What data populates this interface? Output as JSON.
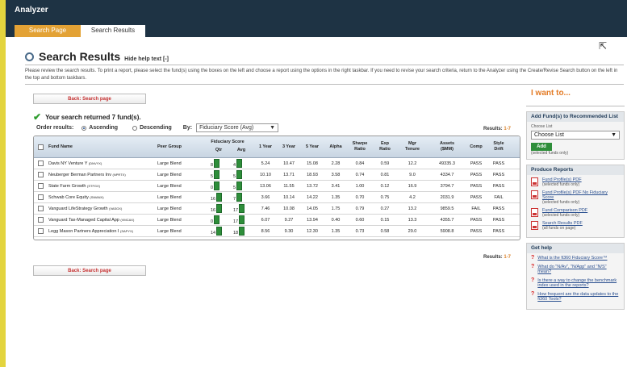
{
  "app": {
    "title": "Analyzer"
  },
  "tabs": [
    {
      "label": "Search Page"
    },
    {
      "label": "Search Results"
    }
  ],
  "header": {
    "title": "Search Results",
    "hide_help": "Hide help text [-]"
  },
  "help_text": "Please review the search results. To print a report, please select the fund(s) using the boxes on the left and choose a report using the options in the right taskbar. If you need to revise your search criteria, return to the Analyzer using the Create/Revise Search button on the left in the top and bottom taskbars.",
  "back_label": "Back: Search page",
  "result_message": "Your search returned 7 fund(s).",
  "order": {
    "label": "Order results:",
    "ascending": "Ascending",
    "descending": "Descending",
    "by_label": "By:",
    "by_value": "Fiduciary Score (Avg)"
  },
  "results_count": {
    "label": "Results:",
    "range": "1-7"
  },
  "table": {
    "headers": {
      "fund_name": "Fund Name",
      "peer_group": "Peer Group",
      "fiduciary_score": "Fiduciary Score",
      "qtr": "Qtr",
      "avg": "Avg",
      "y1": "1 Year",
      "y3": "3 Year",
      "y5": "5 Year",
      "alpha": "Alpha",
      "sharpe": "Sharpe Ratio",
      "exp": "Exp Ratio",
      "mgr": "Mgr Tenure",
      "assets": "Assets ($MM)",
      "comp": "Comp",
      "style": "Style Drift"
    },
    "rows": [
      {
        "name": "Davis NY Venture Y",
        "ticker": "(DNVYX)",
        "peer": "Large Blend",
        "qtr": "8",
        "avg": "4",
        "y1": "5.24",
        "y3": "10.47",
        "y5": "15.08",
        "alpha": "2.28",
        "sharpe": "0.84",
        "exp": "0.59",
        "mgr": "12.2",
        "assets": "49335.3",
        "comp": "PASS",
        "style": "PASS"
      },
      {
        "name": "Neuberger Berman Partners Inv",
        "ticker": "(NPRTX)",
        "peer": "Large Blend",
        "qtr": "5",
        "avg": "5",
        "y1": "10.10",
        "y3": "13.71",
        "y5": "18.93",
        "alpha": "3.58",
        "sharpe": "0.74",
        "exp": "0.81",
        "mgr": "9.0",
        "assets": "4334.7",
        "comp": "PASS",
        "style": "PASS"
      },
      {
        "name": "State Farm Growth",
        "ticker": "(STFGX)",
        "peer": "Large Blend",
        "qtr": "0",
        "avg": "5",
        "y1": "13.06",
        "y3": "11.55",
        "y5": "13.72",
        "alpha": "3.41",
        "sharpe": "1.00",
        "exp": "0.12",
        "mgr": "16.9",
        "assets": "3794.7",
        "comp": "PASS",
        "style": "PASS"
      },
      {
        "name": "Schwab Core Equity",
        "ticker": "(SWANX)",
        "peer": "Large Blend",
        "qtr": "16",
        "avg": "7",
        "y1": "3.66",
        "y3": "10.14",
        "y5": "14.22",
        "alpha": "1.35",
        "sharpe": "0.70",
        "exp": "0.75",
        "mgr": "4.2",
        "assets": "2031.9",
        "comp": "PASS",
        "style": "FAIL"
      },
      {
        "name": "Vanguard LifeStrategy Growth",
        "ticker": "(VASGX)",
        "peer": "Large Blend",
        "qtr": "16",
        "avg": "17",
        "y1": "7.46",
        "y3": "10.08",
        "y5": "14.05",
        "alpha": "1.75",
        "sharpe": "0.79",
        "exp": "0.27",
        "mgr": "13.2",
        "assets": "9859.5",
        "comp": "FAIL",
        "style": "PASS"
      },
      {
        "name": "Vanguard Tax-Managed Capital App",
        "ticker": "(VMCAX)",
        "peer": "Large Blend",
        "qtr": "0",
        "avg": "17",
        "y1": "6.07",
        "y3": "9.27",
        "y5": "13.94",
        "alpha": "0.40",
        "sharpe": "0.60",
        "exp": "0.15",
        "mgr": "13.3",
        "assets": "4355.7",
        "comp": "PASS",
        "style": "PASS"
      },
      {
        "name": "Legg Mason Partners Appreciation I",
        "ticker": "(SAPYX)",
        "peer": "Large Blend",
        "qtr": "14",
        "avg": "18",
        "y1": "8.56",
        "y3": "9.30",
        "y5": "12.30",
        "alpha": "1.35",
        "sharpe": "0.73",
        "exp": "0.58",
        "mgr": "29.0",
        "assets": "5908.8",
        "comp": "PASS",
        "style": "PASS"
      }
    ]
  },
  "sidebar": {
    "title": "I want to...",
    "add_box": {
      "title": "Add Fund(s) to Recommended List",
      "choose_label": "Choose List",
      "select_value": "Choose List",
      "add_button": "Add",
      "note": "(selected funds only)"
    },
    "reports": {
      "title": "Produce Reports",
      "items": [
        {
          "label": "Fund Profile(s) PDF",
          "note": "(selected funds only)"
        },
        {
          "label": "Fund Profile(s) PDF No Fiduciary Score",
          "note": "(selected funds only)"
        },
        {
          "label": "Fund Comparison PDF",
          "note": "(selected funds only)"
        },
        {
          "label": "Search Results PDF",
          "note": "(all funds on page)"
        }
      ]
    },
    "help": {
      "title": "Get help",
      "items": [
        "What is the fi360 Fiduciary Score™",
        "What do \"N/Av\", \"N/App\" and \"N/S\" mean?",
        "Is there a way to change the benchmark index used in the reports?",
        "How frequent are the data updates to the fi360 Tools?"
      ]
    }
  },
  "colors": {
    "accent": "#e3a235",
    "header_bg": "#1e3344",
    "score_green": "#2e8e3a",
    "outer_bg": "#e3d43e"
  },
  "icons": [
    "magnifier-icon",
    "checkmark-icon",
    "pdf-icon",
    "question-icon",
    "cursor-icon",
    "chevron-down-icon"
  ]
}
